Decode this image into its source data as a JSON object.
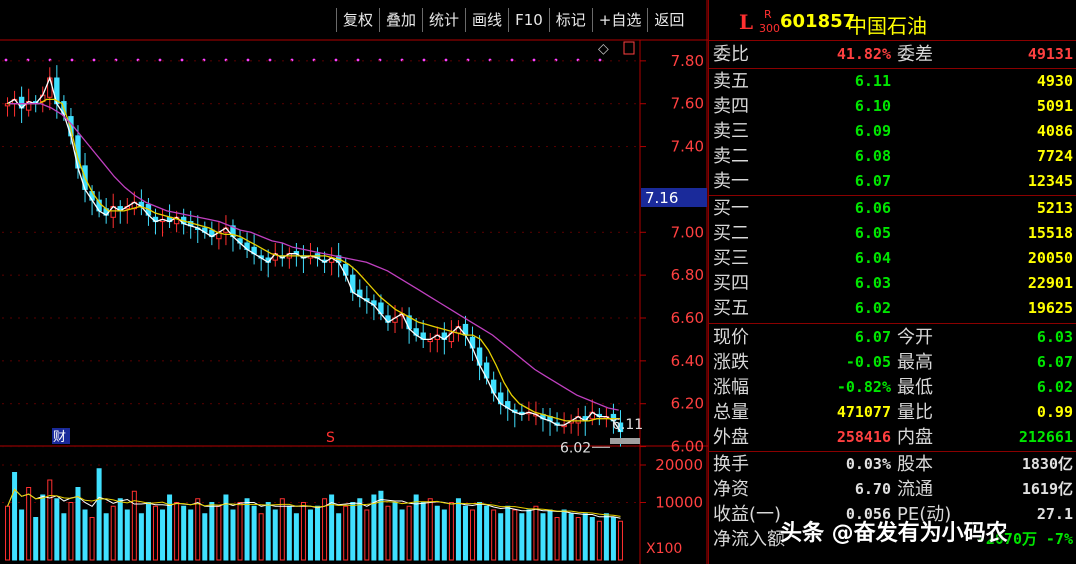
{
  "toolbar": {
    "buttons": [
      "复权",
      "叠加",
      "统计",
      "画线",
      "F10",
      "标记",
      "+自选",
      "返回"
    ]
  },
  "header": {
    "mark": "L",
    "badge_top": "R",
    "badge_bottom": "300",
    "code": "601857",
    "name": "中国石油"
  },
  "chart_data": {
    "type": "candlestick",
    "price_ticks": [
      "7.80",
      "7.60",
      "7.40",
      "7.00",
      "6.80",
      "6.60",
      "6.40",
      "6.20",
      "6.00"
    ],
    "current_price_label": "7.16",
    "high_annotation": "6.11",
    "low_annotation": "6.02",
    "finance_marker": "财",
    "s_marker": "S",
    "volume_ticks": [
      "20000",
      "10000"
    ],
    "volume_unit": "X100",
    "close_series": [
      7.6,
      7.62,
      7.58,
      7.61,
      7.6,
      7.64,
      7.72,
      7.6,
      7.55,
      7.45,
      7.3,
      7.2,
      7.15,
      7.1,
      7.08,
      7.12,
      7.1,
      7.12,
      7.14,
      7.12,
      7.08,
      7.05,
      7.06,
      7.05,
      7.07,
      7.04,
      7.03,
      7.02,
      7.0,
      6.98,
      7.0,
      7.02,
      6.98,
      6.95,
      6.92,
      6.9,
      6.88,
      6.86,
      6.9,
      6.88,
      6.9,
      6.9,
      6.88,
      6.89,
      6.88,
      6.86,
      6.88,
      6.86,
      6.8,
      6.72,
      6.7,
      6.68,
      6.66,
      6.62,
      6.58,
      6.6,
      6.62,
      6.55,
      6.52,
      6.5,
      6.5,
      6.52,
      6.5,
      6.53,
      6.56,
      6.52,
      6.46,
      6.38,
      6.32,
      6.25,
      6.2,
      6.18,
      6.16,
      6.15,
      6.16,
      6.15,
      6.13,
      6.12,
      6.1,
      6.1,
      6.12,
      6.14,
      6.12,
      6.16,
      6.14,
      6.14,
      6.12,
      6.07
    ],
    "ma_fast": [
      7.6,
      7.6,
      7.6,
      7.6,
      7.6,
      7.62,
      7.62,
      7.6,
      7.5,
      7.35,
      7.25,
      7.18,
      7.13,
      7.1,
      7.1,
      7.1,
      7.11,
      7.12,
      7.11,
      7.09,
      7.08,
      7.07,
      7.06,
      7.05,
      7.04,
      7.03,
      7.02,
      7.0,
      6.99,
      6.99,
      6.98,
      6.96,
      6.94,
      6.92,
      6.9,
      6.89,
      6.89,
      6.89,
      6.89,
      6.89,
      6.89,
      6.89,
      6.88,
      6.87,
      6.85,
      6.82,
      6.78,
      6.74,
      6.7,
      6.67,
      6.64,
      6.62,
      6.6,
      6.58,
      6.57,
      6.56,
      6.55,
      6.54,
      6.53,
      6.52,
      6.52,
      6.5,
      6.45,
      6.38,
      6.3,
      6.24,
      6.2,
      6.18,
      6.16,
      6.15,
      6.14,
      6.13,
      6.12,
      6.12,
      6.12,
      6.12,
      6.13,
      6.13,
      6.13,
      6.13
    ],
    "ma_slow": [
      7.6,
      7.6,
      7.6,
      7.6,
      7.58,
      7.55,
      7.5,
      7.44,
      7.38,
      7.32,
      7.26,
      7.21,
      7.17,
      7.14,
      7.12,
      7.1,
      7.09,
      7.08,
      7.07,
      7.06,
      7.05,
      7.03,
      7.01,
      7.0,
      6.98,
      6.96,
      6.95,
      6.93,
      6.92,
      6.91,
      6.9,
      6.89,
      6.88,
      6.87,
      6.86,
      6.84,
      6.82,
      6.79,
      6.76,
      6.73,
      6.7,
      6.67,
      6.64,
      6.61,
      6.58,
      6.55,
      6.52,
      6.48,
      6.44,
      6.4,
      6.36,
      6.33,
      6.3,
      6.27,
      6.24,
      6.22,
      6.2,
      6.18,
      6.17
    ],
    "volumes": [
      9,
      18,
      8,
      14,
      6,
      12,
      16,
      11,
      7,
      10,
      14,
      8,
      6,
      19,
      7,
      9,
      11,
      8,
      13,
      7,
      10,
      9,
      8,
      12,
      10,
      9,
      8,
      11,
      7,
      10,
      9,
      12,
      8,
      10,
      11,
      9,
      7,
      10,
      8,
      11,
      9,
      7,
      10,
      8,
      9,
      11,
      12,
      7,
      9,
      10,
      11,
      8,
      12,
      13,
      9,
      10,
      8,
      9,
      12,
      10,
      11,
      9,
      8,
      10,
      11,
      9,
      8,
      10,
      9,
      8,
      7,
      9,
      8,
      7,
      8,
      9,
      7,
      8,
      6,
      8,
      7,
      6,
      7,
      6,
      5,
      7,
      6,
      5
    ]
  },
  "quote": {
    "weibi_label": "委比",
    "weibi_value": "41.82%",
    "weicha_label": "委差",
    "weicha_value": "49131",
    "asks": [
      {
        "label": "卖五",
        "price": "6.11",
        "vol": "4930"
      },
      {
        "label": "卖四",
        "price": "6.10",
        "vol": "5091"
      },
      {
        "label": "卖三",
        "price": "6.09",
        "vol": "4086"
      },
      {
        "label": "卖二",
        "price": "6.08",
        "vol": "7724"
      },
      {
        "label": "卖一",
        "price": "6.07",
        "vol": "12345"
      }
    ],
    "bids": [
      {
        "label": "买一",
        "price": "6.06",
        "vol": "5213"
      },
      {
        "label": "买二",
        "price": "6.05",
        "vol": "15518"
      },
      {
        "label": "买三",
        "price": "6.04",
        "vol": "20050"
      },
      {
        "label": "买四",
        "price": "6.03",
        "vol": "22901"
      },
      {
        "label": "买五",
        "price": "6.02",
        "vol": "19625"
      }
    ],
    "stats": [
      {
        "l1": "现价",
        "v1": "6.07",
        "c1": "#00e600",
        "l2": "今开",
        "v2": "6.03",
        "c2": "#00e600"
      },
      {
        "l1": "涨跌",
        "v1": "-0.05",
        "c1": "#00e600",
        "l2": "最高",
        "v2": "6.07",
        "c2": "#00e600"
      },
      {
        "l1": "涨幅",
        "v1": "-0.82%",
        "c1": "#00e600",
        "l2": "最低",
        "v2": "6.02",
        "c2": "#00e600"
      },
      {
        "l1": "总量",
        "v1": "471077",
        "c1": "#ffff00",
        "l2": "量比",
        "v2": "0.99",
        "c2": "#ffff00"
      },
      {
        "l1": "外盘",
        "v1": "258416",
        "c1": "#ff4040",
        "l2": "内盘",
        "v2": "212661",
        "c2": "#00e600"
      }
    ],
    "fin": [
      {
        "l1": "换手",
        "v1": "0.03%",
        "l2": "股本",
        "v2": "1830亿"
      },
      {
        "l1": "净资",
        "v1": "6.70",
        "l2": "流通",
        "v2": "1619亿"
      },
      {
        "l1": "收益(一)",
        "v1": "0.056",
        "l2": "PE(动)",
        "v2": "27.1"
      }
    ],
    "net_inflow_label": "净流入额",
    "net_inflow_value": "-2070万",
    "net_inflow_pct": "-7%"
  },
  "watermark": "头条 @奋发有为小码农"
}
